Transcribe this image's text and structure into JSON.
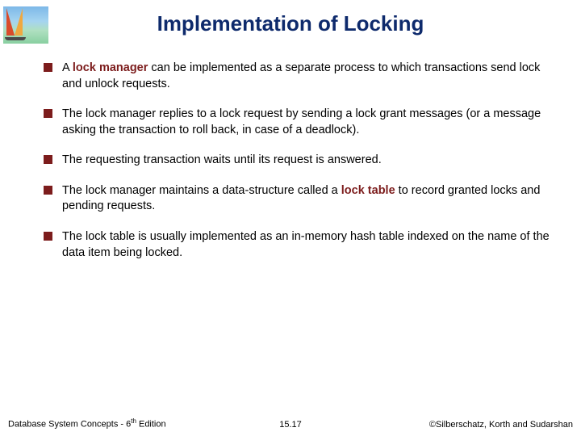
{
  "title": "Implementation of Locking",
  "bullets": [
    {
      "pre": "A ",
      "key": "lock manager",
      "post": " can be implemented as a separate process to which transactions send lock and unlock requests."
    },
    {
      "pre": "The lock manager replies to a lock request by sending a lock grant messages (or a message asking the transaction to roll back, in case of a deadlock).",
      "key": "",
      "post": ""
    },
    {
      "pre": "The requesting transaction waits until its request is answered.",
      "key": "",
      "post": ""
    },
    {
      "pre": "The lock manager maintains a data-structure called a ",
      "key": "lock table",
      "post": " to record granted locks and pending requests."
    },
    {
      "pre": "The lock table is usually implemented as an in-memory hash table indexed on the name of the data item being locked.",
      "key": "",
      "post": ""
    }
  ],
  "footer": {
    "left_pre": "Database System Concepts - 6",
    "left_sup": "th",
    "left_post": " Edition",
    "center": "15.17",
    "right": "©Silberschatz, Korth and Sudarshan"
  }
}
